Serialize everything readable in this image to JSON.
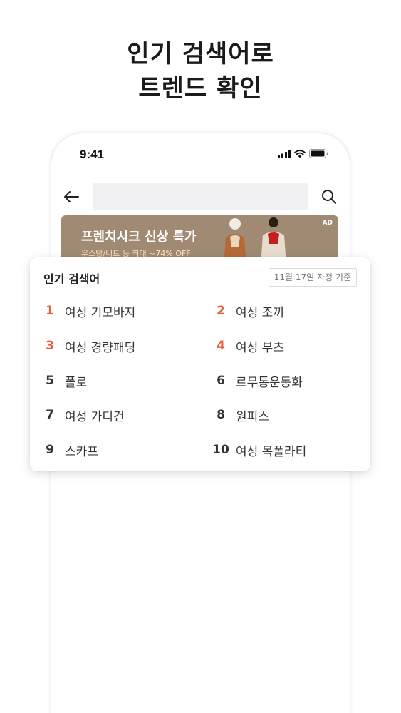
{
  "headline": {
    "line1": "인기 검색어로",
    "line2": "트렌드 확인"
  },
  "status_bar": {
    "time": "9:41"
  },
  "search": {
    "value": ""
  },
  "banner": {
    "title": "프렌치시크 신상 특가",
    "subtitle": "무스탕/니트 등 최대 ~74% OFF",
    "ad_label": "AD"
  },
  "popular": {
    "title": "인기 검색어",
    "date_badge": "11월 17일 자정 기준",
    "highlight_color": "#e8603a",
    "items": [
      {
        "rank": "1",
        "term": "여성 기모바지"
      },
      {
        "rank": "2",
        "term": "여성 조끼"
      },
      {
        "rank": "3",
        "term": "여성 경량패딩"
      },
      {
        "rank": "4",
        "term": "여성 부츠"
      },
      {
        "rank": "5",
        "term": "폴로"
      },
      {
        "rank": "6",
        "term": "르무통운동화"
      },
      {
        "rank": "7",
        "term": "여성 가디건"
      },
      {
        "rank": "8",
        "term": "원피스"
      },
      {
        "rank": "9",
        "term": "스카프"
      },
      {
        "rank": "10",
        "term": "여성 목폴라티"
      }
    ]
  },
  "icons": [
    "back-arrow-icon",
    "search-icon",
    "signal-icon",
    "wifi-icon",
    "battery-icon"
  ]
}
